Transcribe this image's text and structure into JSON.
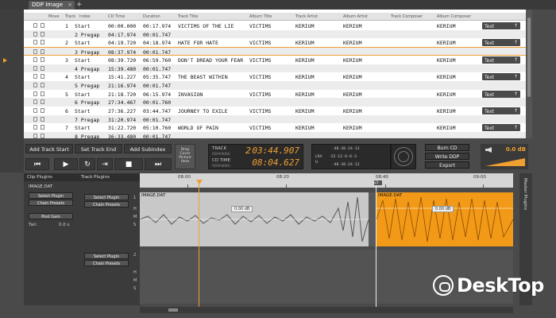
{
  "tab": {
    "title": "DDP Image",
    "close": "×",
    "add": "+"
  },
  "columns": {
    "move": "Move",
    "track": "Track",
    "index": "Index",
    "cd_time": "CD Time",
    "duration": "Duration",
    "track_title": "Track Title",
    "album_title": "Album Title",
    "track_artist": "Track Artist",
    "album_artist": "Album Artist",
    "track_composer": "Track Composer",
    "album_composer": "Album Composer"
  },
  "rows": [
    {
      "track": "1",
      "index": "Start",
      "cd_time": "00:00.000",
      "duration": "00:17.974",
      "title": "VICTIMS OF THE LIE",
      "album": "VICTIMS",
      "artist": "KERIUM",
      "album_artist": "KERIUM",
      "composer": "KERIUM",
      "text": "Text"
    },
    {
      "track": "",
      "index": "2 Pregap",
      "cd_time": "04:17.974",
      "duration": "00:01.747",
      "title": "",
      "album": "",
      "artist": "",
      "album_artist": "",
      "composer": "",
      "text": ""
    },
    {
      "track": "2",
      "index": "Start",
      "cd_time": "04:19.720",
      "duration": "04:18.974",
      "title": "HATE FOR HATE",
      "album": "VICTIMS",
      "artist": "KERIUM",
      "album_artist": "KERIUM",
      "composer": "KERIUM",
      "text": "Text"
    },
    {
      "track": "",
      "index": "3 Pregap",
      "cd_time": "08:37.974",
      "duration": "00:01.747",
      "title": "",
      "album": "",
      "artist": "",
      "album_artist": "",
      "composer": "",
      "text": ""
    },
    {
      "track": "3",
      "index": "Start",
      "cd_time": "08:39.720",
      "duration": "06:59.760",
      "title": "DON'T DREAD YOUR FEAR",
      "album": "VICTIMS",
      "artist": "KERIUM",
      "album_artist": "KERIUM",
      "composer": "KERIUM",
      "text": "Text"
    },
    {
      "track": "",
      "index": "4 Pregap",
      "cd_time": "15:39.480",
      "duration": "00:01.747",
      "title": "",
      "album": "",
      "artist": "",
      "album_artist": "",
      "composer": "",
      "text": ""
    },
    {
      "track": "4",
      "index": "Start",
      "cd_time": "15:41.227",
      "duration": "05:35.747",
      "title": "THE BEAST WITHIN",
      "album": "VICTIMS",
      "artist": "KERIUM",
      "album_artist": "KERIUM",
      "composer": "KERIUM",
      "text": "Text"
    },
    {
      "track": "",
      "index": "5 Pregap",
      "cd_time": "21:16.974",
      "duration": "00:01.747",
      "title": "",
      "album": "",
      "artist": "",
      "album_artist": "",
      "composer": "",
      "text": ""
    },
    {
      "track": "5",
      "index": "Start",
      "cd_time": "21:18.720",
      "duration": "06:15.974",
      "title": "INVASION",
      "album": "VICTIMS",
      "artist": "KERIUM",
      "album_artist": "KERIUM",
      "composer": "KERIUM",
      "text": "Text"
    },
    {
      "track": "",
      "index": "6 Pregap",
      "cd_time": "27:34.467",
      "duration": "00:01.760",
      "title": "",
      "album": "",
      "artist": "",
      "album_artist": "",
      "composer": "",
      "text": ""
    },
    {
      "track": "6",
      "index": "Start",
      "cd_time": "27:36.227",
      "duration": "03:44.747",
      "title": "JOURNEY TO EXILE",
      "album": "VICTIMS",
      "artist": "KERIUM",
      "album_artist": "KERIUM",
      "composer": "KERIUM",
      "text": "Text"
    },
    {
      "track": "",
      "index": "7 Pregap",
      "cd_time": "31:20.974",
      "duration": "00:01.747",
      "title": "",
      "album": "",
      "artist": "",
      "album_artist": "",
      "composer": "",
      "text": ""
    },
    {
      "track": "7",
      "index": "Start",
      "cd_time": "31:22.720",
      "duration": "05:10.760",
      "title": "WORLD OF PAIN",
      "album": "VICTIMS",
      "artist": "KERIUM",
      "album_artist": "KERIUM",
      "composer": "KERIUM",
      "text": "Text"
    },
    {
      "track": "",
      "index": "8 Pregap",
      "cd_time": "36:33.480",
      "duration": "00:01.747",
      "title": "",
      "album": "",
      "artist": "",
      "album_artist": "",
      "composer": "",
      "text": ""
    }
  ],
  "transport": {
    "add_track_start": "Add Track Start",
    "set_track_end": "Set Track End",
    "add_subindex": "Add Subindex",
    "rewind": "⏮",
    "play": "▶",
    "loop": "↻",
    "step": "⇥",
    "stop": "■",
    "forward": "⏭"
  },
  "cover": {
    "label": "Drop Cover Picture Here"
  },
  "time": {
    "track_label": "TRACK",
    "track_sub": "REMAINING",
    "track_num": "2",
    "track_value": "03:44.907",
    "cd_label": "CD TIME",
    "cd_sub": "REMAINING",
    "cd_value": "08:04.627"
  },
  "meter": {
    "row1": "-48  -36  -24  -12",
    "row2": "-15 -12 -9 -6 -3",
    "row3": "-48  -36  -24  -12",
    "lr": "LRA",
    "u": "U"
  },
  "right_buttons": {
    "burn_cd": "Burn CD",
    "write_ddp": "Write DDP",
    "export": "Export"
  },
  "volume": {
    "db": "0.0 dB"
  },
  "clip_plugins": {
    "title": "Clip Plugins",
    "clip_name": "IMAGE.DAT",
    "select_plugin": "Select Plugin",
    "chain_presets": "Chain Presets",
    "post_gain": "Post Gain",
    "tail_label": "Tail:",
    "tail_value": "0.0 s"
  },
  "track_plugins": {
    "title": "Track Plugins",
    "select_plugin": "Select Plugin",
    "chain_presets": "Chain Presets",
    "lane1_num": "1",
    "lane2_num": "2",
    "h": "H",
    "m": "M",
    "s": "S"
  },
  "ruler": {
    "t1": "08:00",
    "t2": "08:20",
    "t3": "08:40",
    "t4": "09:00",
    "marker": "⌂3"
  },
  "clips": {
    "clip1": "IMAGE.DAT",
    "clip2": "IMAGE.DAT",
    "db1": "0.00 dB",
    "db2": "0.00 dB"
  },
  "master_plugins": {
    "title": "Master Plugins"
  },
  "watermark": {
    "text": "DeskTop"
  },
  "colors": {
    "accent": "#f0a030",
    "clip_orange": "#f29a18",
    "panel": "#3b3b3b"
  }
}
